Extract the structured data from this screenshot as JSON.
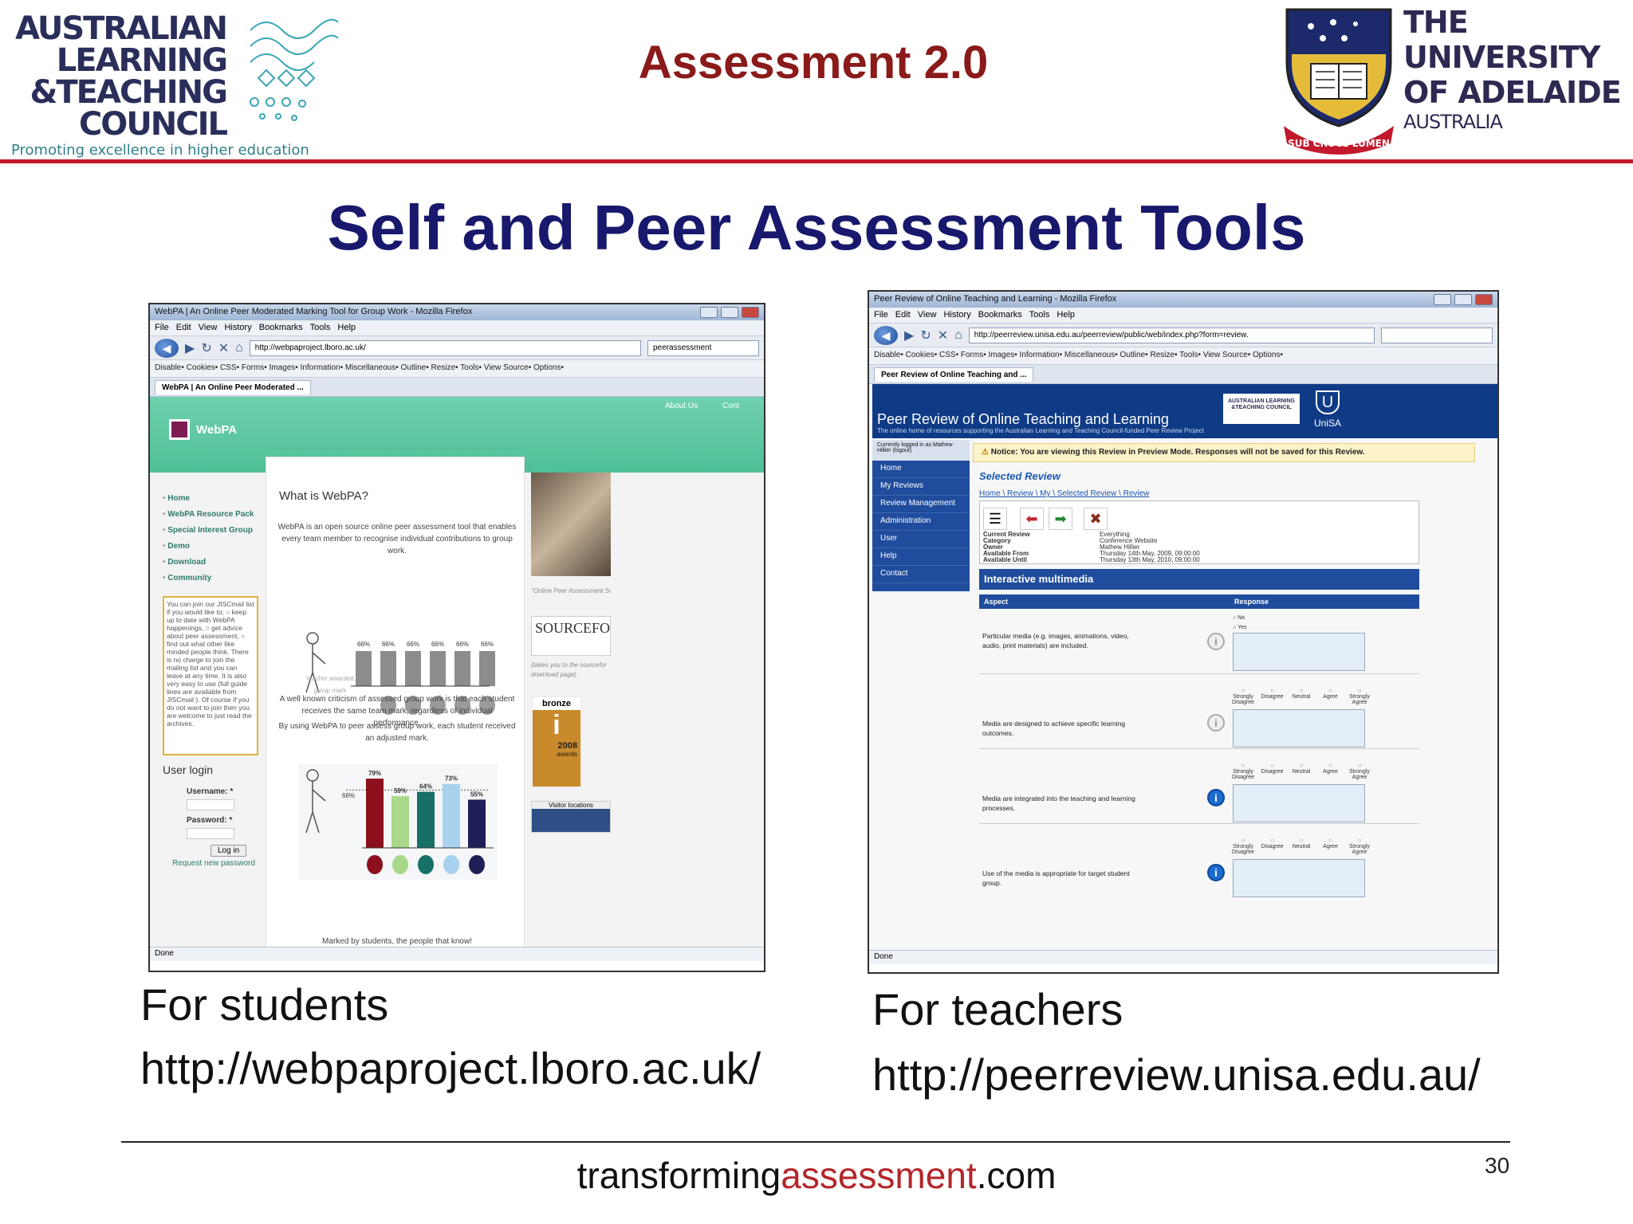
{
  "header": {
    "altc_name_lines": [
      "AUSTRALIAN",
      "LEARNING",
      "&TEACHING",
      "COUNCIL"
    ],
    "altc_tagline": "Promoting excellence in higher education",
    "deck_title": "Assessment 2.0",
    "uoa_lines": [
      "THE UNIVERSITY",
      "OF ADELAIDE",
      "AUSTRALIA"
    ],
    "uoa_motto": "SUB CRUCE LUMEN"
  },
  "slide_title": "Self and Peer Assessment Tools",
  "left_shot": {
    "window_title": "WebPA | An Online Peer Moderated Marking Tool for Group Work - Mozilla Firefox",
    "menu": "File Edit View History Bookmarks Tools Help",
    "url": "http://webpaproject.lboro.ac.uk/",
    "search": "peerassessment",
    "toolbar": "Disable• Cookies• CSS• Forms• Images• Information• Miscellaneous• Outline• Resize• Tools• View Source• Options•",
    "tab": "WebPA | An Online Peer Moderated ...",
    "logo_text": "WebPA",
    "topnav": [
      "About Us",
      "Cont"
    ],
    "nav": [
      "Home",
      "WebPA Resource Pack",
      "Special Interest Group",
      "Demo",
      "Download",
      "Community"
    ],
    "jisc_text": "You can join our JISCmail list if you would like to; ○ keep up to date with WebPA happenings, ○ get advice about peer assessment, ○ find out what other like minded people think. There is no charge to join the mailing list and you can leave at any time. It is also very easy to use (full guide lines are available from JISCmail ). Of course if you do not want to join then you are welcome to just read the archives.",
    "login_title": "User login",
    "username_label": "Username: *",
    "password_label": "Password: *",
    "login_button": "Log in",
    "request_link": "Request new password",
    "main_heading": "What is WebPA?",
    "intro": "WebPA is an open source online peer assessment tool that enables every team member to recognise individual contributions to group work.",
    "criticism": "A well known criticism of assessed group work is that each student receives the same team mark, regardless of individual performance.",
    "using": "By using WebPA to peer assess group work, each student received an adjusted mark.",
    "marked_by": "Marked by students, the people that know!",
    "grey_values": [
      "66%",
      "66%",
      "66%",
      "66%",
      "66%",
      "66%"
    ],
    "grey_note": "teacher awarded group mark",
    "color_values": [
      79,
      59,
      64,
      73,
      55
    ],
    "color_labels": [
      "79%",
      "59%",
      "64%",
      "73%",
      "55%"
    ],
    "color_ref": "66%",
    "right_caption": "\"Online Peer Assessment Software for Higher Educat",
    "sourceforge": "SOURCEFOR",
    "sourceforge_note": "(takes you to the sourcefor download page)",
    "award_text": "bronze",
    "award_year": "2008",
    "award_sub": "awards",
    "visitor": "Visitor locations",
    "status": "Done"
  },
  "right_shot": {
    "window_title": "Peer Review of Online Teaching and Learning - Mozilla Firefox",
    "menu": "File Edit View History Bookmarks Tools Help",
    "url": "http://peerreview.unisa.edu.au/peerreview/public/web/index.php?form=review.",
    "toolbar": "Disable• Cookies• CSS• Forms• Images• Information• Miscellaneous• Outline• Resize• Tools• View Source• Options•",
    "tab": "Peer Review of Online Teaching and ...",
    "site_title": "Peer Review of Online Teaching and Learning",
    "site_sub": "The online home of resources supporting the Australian Learning and Teaching Council-funded Peer Review Project",
    "altc_small": "AUSTRALIAN LEARNING &TEACHING COUNCIL",
    "unisa": "UniSA",
    "logged_in": "Currently logged in as Mathew Hillier (logout)",
    "nav": [
      "Home",
      "My Reviews",
      "Review Management",
      "Administration",
      "User",
      "Help",
      "Contact"
    ],
    "notice": "Notice: You are viewing this Review in Preview Mode. Responses will not be saved for this Review.",
    "selected": "Selected Review",
    "breadcrumb": "Home \\ Review \\ My \\ Selected Review \\ Review",
    "info_keys": [
      "Current Review",
      "Category",
      "Owner",
      "Available From",
      "Available Until"
    ],
    "info_vals": [
      "Everything",
      "Conference Website",
      "Mathew Hillier",
      "Thursday 14th May, 2009, 09:00:00",
      "Thursday 13th May, 2010, 09:00:00"
    ],
    "section": "Interactive multimedia",
    "col_aspect": "Aspect",
    "col_response": "Response",
    "yes_no": [
      "No",
      "Yes"
    ],
    "scale": [
      "Strongly Disagree",
      "Disagree",
      "Neutral",
      "Agree",
      "Strongly Agree"
    ],
    "questions": [
      "Particular media (e.g. images, animations, video, audio, print materials) are included.",
      "Media are designed to achieve specific learning outcomes.",
      "Media are integrated into the teaching and learning processes.",
      "Use of the media is appropriate for target student group."
    ],
    "status": "Done"
  },
  "captions": {
    "left_title": "For students",
    "left_url": "http://webpaproject.lboro.ac.uk/",
    "right_title": "For teachers",
    "right_url": "http://peerreview.unisa.edu.au/"
  },
  "footer": {
    "pre": "transforming",
    "hl": "assessment",
    "post": ".com"
  },
  "page_number": "30",
  "colors": {
    "title_red": "#8b1a1a",
    "title_navy": "#18186d",
    "rule_red": "#c21a2c",
    "webpa_green": "#4fbf96",
    "unisa_blue": "#0f3b86"
  }
}
